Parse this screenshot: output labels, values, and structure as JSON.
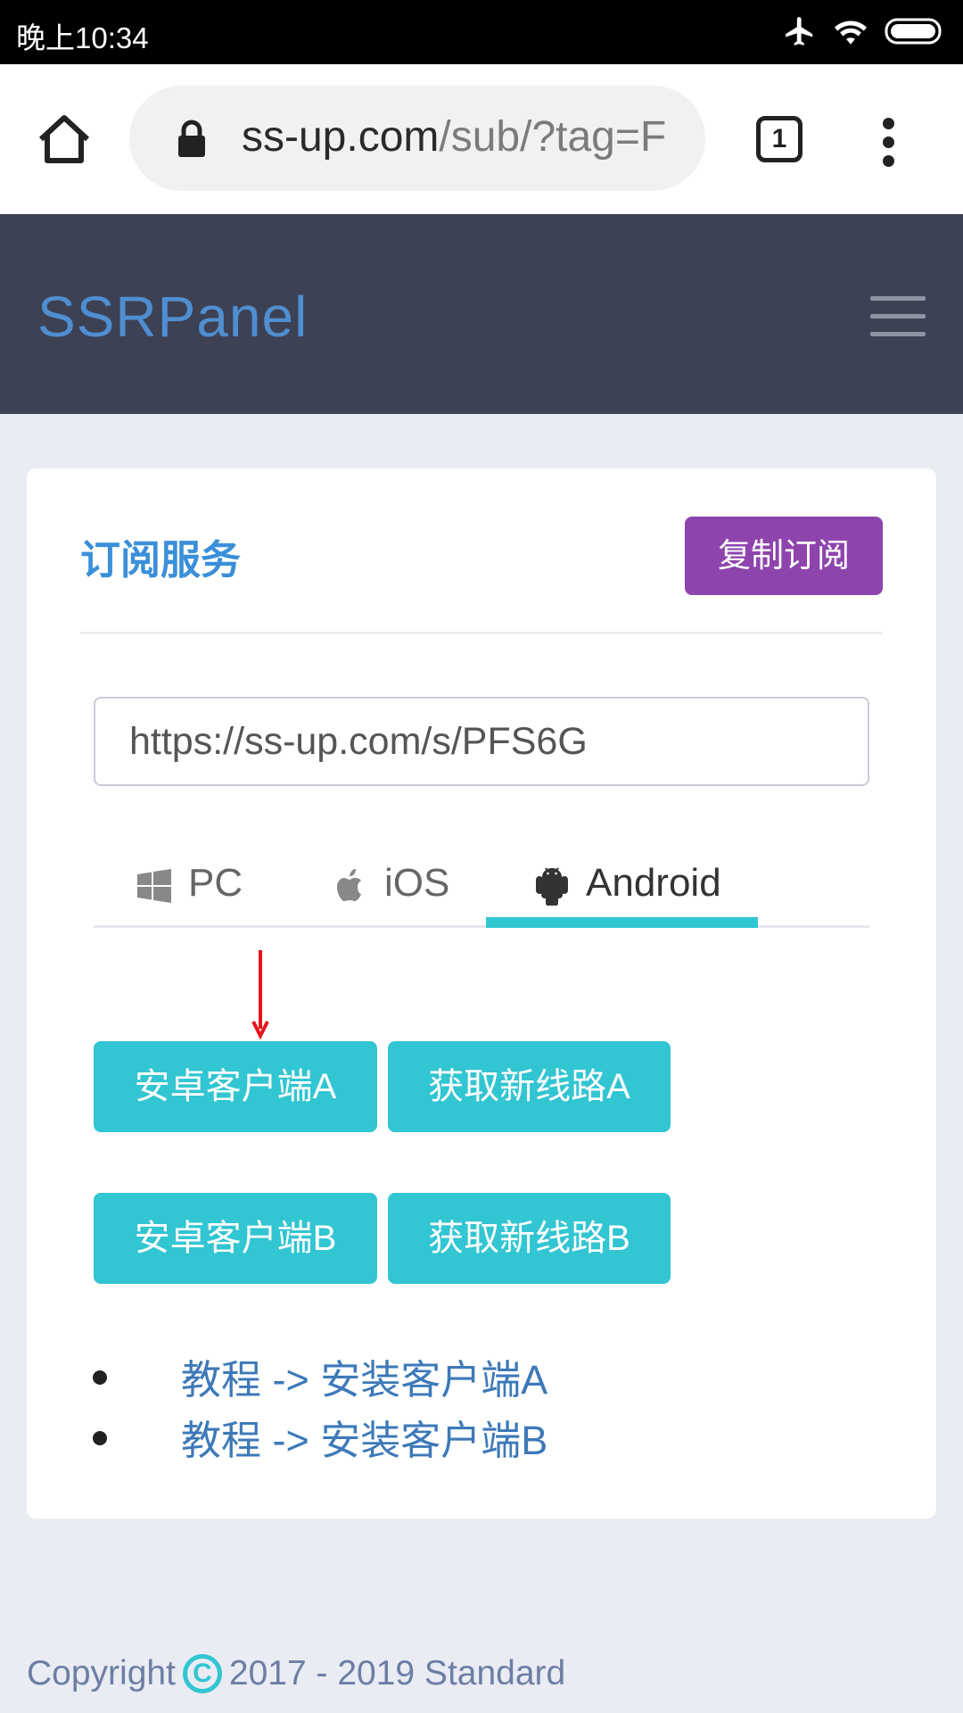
{
  "status_bar": {
    "time": "晚上10:34",
    "icons": [
      "airplane-icon",
      "wifi-icon",
      "battery-icon"
    ]
  },
  "browser": {
    "url_host": "ss-up.com",
    "url_path": "/sub/?tag=F",
    "tab_count": "1"
  },
  "header": {
    "brand": "SSRPanel"
  },
  "card": {
    "title": "订阅服务",
    "copy_button": "复制订阅",
    "subscription_url": "https://ss-up.com/s/PFS6G",
    "tabs": [
      {
        "label": "PC",
        "icon": "windows-icon",
        "active": false
      },
      {
        "label": "iOS",
        "icon": "apple-icon",
        "active": false
      },
      {
        "label": "Android",
        "icon": "android-icon",
        "active": true
      }
    ],
    "buttons": [
      "安卓客户端A",
      "获取新线路A",
      "安卓客户端B",
      "获取新线路B"
    ],
    "links": [
      "教程 -> 安装客户端A",
      "教程 -> 安装客户端B"
    ]
  },
  "footer": {
    "prefix": "Copyright",
    "symbol": "C",
    "suffix": "2017 - 2019 Standard"
  },
  "colors": {
    "header_bg": "#3d4154",
    "brand": "#4f8ed0",
    "accent_cyan": "#32c5d2",
    "copy_button": "#8e44ad",
    "link": "#3d79b8",
    "annotation_arrow": "#e8141c"
  }
}
